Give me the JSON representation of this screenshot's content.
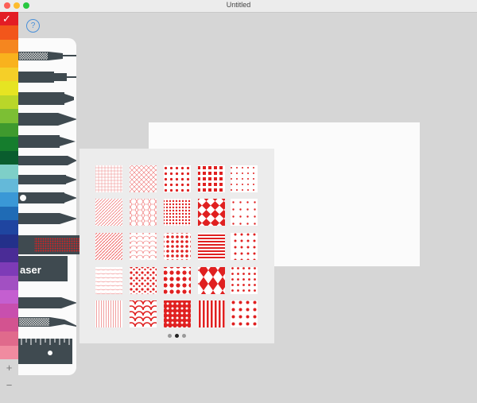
{
  "window": {
    "title": "Untitled"
  },
  "help": {
    "label": "?"
  },
  "zoom": {
    "in": "+",
    "out": "−"
  },
  "swatches": {
    "check_glyph": "✓",
    "colors": [
      "#e31d25",
      "#f2561b",
      "#f5861f",
      "#f9b21d",
      "#f5cf28",
      "#e6e422",
      "#b9d629",
      "#7cbf34",
      "#3f9a2e",
      "#157d2d",
      "#0a5d2e",
      "#7ecfc8",
      "#64b9d9",
      "#3a98d6",
      "#1f6bb5",
      "#1f45a0",
      "#23308a",
      "#4a2c96",
      "#7e3bb7",
      "#a250c2",
      "#c45fd0",
      "#c84fae",
      "#d35390",
      "#e06a8c",
      "#f08ba0"
    ]
  },
  "tools": {
    "eraser_label": "aser"
  },
  "patterns": {
    "accent": "#e02020",
    "page_count": 3,
    "current_page": 1
  }
}
